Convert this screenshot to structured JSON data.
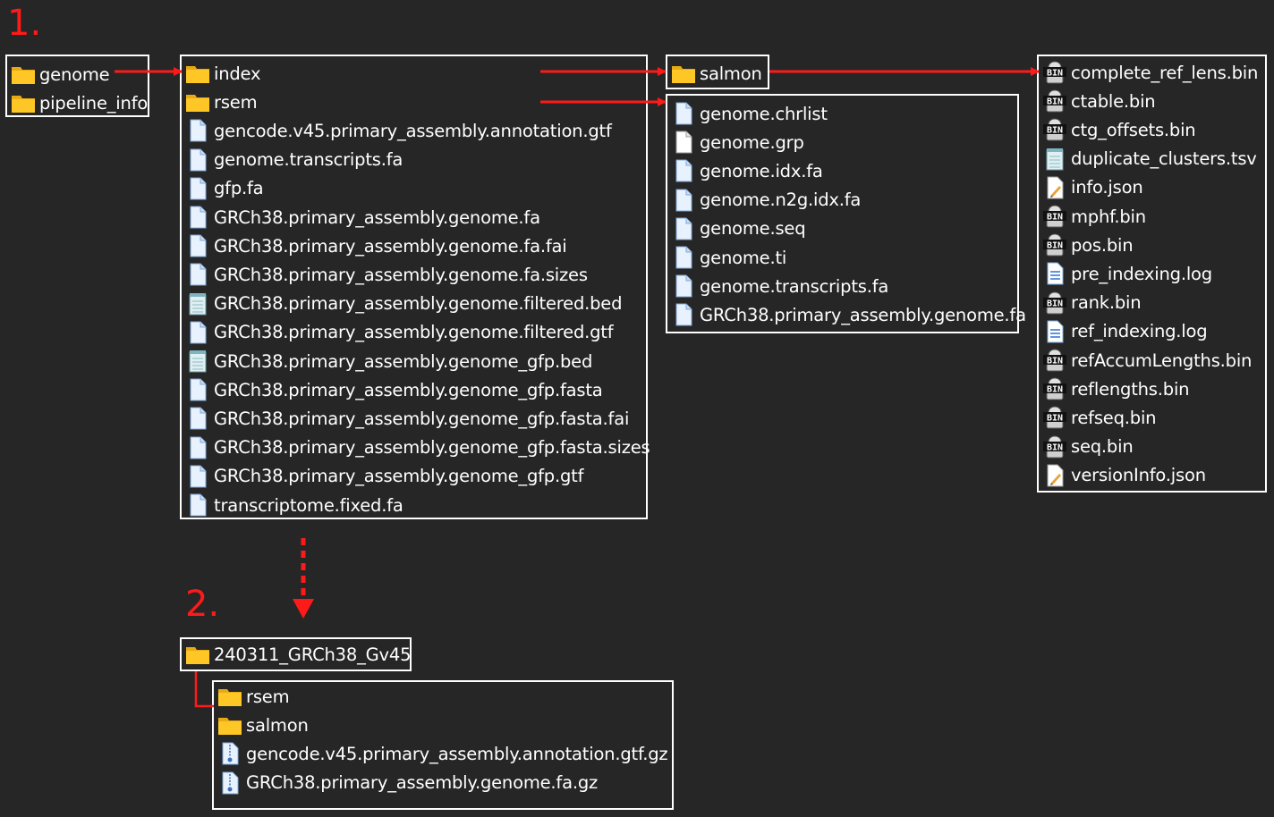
{
  "steps": {
    "one": "1.",
    "two": "2."
  },
  "colors": {
    "background": "#262626",
    "arrow": "#ff1a1a",
    "border": "#ffffff",
    "folder": "#ffc726"
  },
  "root_box": [
    {
      "name": "genome",
      "icon": "folder-icon"
    },
    {
      "name": "pipeline_info",
      "icon": "folder-icon"
    }
  ],
  "genome_box": [
    {
      "name": "index",
      "icon": "folder-icon"
    },
    {
      "name": "rsem",
      "icon": "folder-icon"
    },
    {
      "name": "gencode.v45.primary_assembly.annotation.gtf",
      "icon": "file-icon"
    },
    {
      "name": "genome.transcripts.fa",
      "icon": "file-icon"
    },
    {
      "name": "gfp.fa",
      "icon": "file-icon"
    },
    {
      "name": "GRCh38.primary_assembly.genome.fa",
      "icon": "file-icon"
    },
    {
      "name": "GRCh38.primary_assembly.genome.fa.fai",
      "icon": "file-icon"
    },
    {
      "name": "GRCh38.primary_assembly.genome.fa.sizes",
      "icon": "file-icon"
    },
    {
      "name": "GRCh38.primary_assembly.genome.filtered.bed",
      "icon": "notepad-icon"
    },
    {
      "name": "GRCh38.primary_assembly.genome.filtered.gtf",
      "icon": "file-icon"
    },
    {
      "name": "GRCh38.primary_assembly.genome_gfp.bed",
      "icon": "notepad-icon"
    },
    {
      "name": "GRCh38.primary_assembly.genome_gfp.fasta",
      "icon": "file-icon"
    },
    {
      "name": "GRCh38.primary_assembly.genome_gfp.fasta.fai",
      "icon": "file-icon"
    },
    {
      "name": "GRCh38.primary_assembly.genome_gfp.fasta.sizes",
      "icon": "file-icon"
    },
    {
      "name": "GRCh38.primary_assembly.genome_gfp.gtf",
      "icon": "file-icon"
    },
    {
      "name": "transcriptome.fixed.fa",
      "icon": "file-icon"
    }
  ],
  "index_box": [
    {
      "name": "salmon",
      "icon": "folder-icon"
    }
  ],
  "rsem_box": [
    {
      "name": "genome.chrlist",
      "icon": "file-icon"
    },
    {
      "name": "genome.grp",
      "icon": "blank-file-icon"
    },
    {
      "name": "genome.idx.fa",
      "icon": "file-icon"
    },
    {
      "name": "genome.n2g.idx.fa",
      "icon": "file-icon"
    },
    {
      "name": "genome.seq",
      "icon": "file-icon"
    },
    {
      "name": "genome.ti",
      "icon": "file-icon"
    },
    {
      "name": "genome.transcripts.fa",
      "icon": "file-icon"
    },
    {
      "name": "GRCh38.primary_assembly.genome.fa",
      "icon": "file-icon"
    }
  ],
  "salmon_box": [
    {
      "name": "complete_ref_lens.bin",
      "icon": "bin-icon"
    },
    {
      "name": "ctable.bin",
      "icon": "bin-icon"
    },
    {
      "name": "ctg_offsets.bin",
      "icon": "bin-icon"
    },
    {
      "name": "duplicate_clusters.tsv",
      "icon": "notepad-icon"
    },
    {
      "name": "info.json",
      "icon": "json-icon"
    },
    {
      "name": "mphf.bin",
      "icon": "bin-icon"
    },
    {
      "name": "pos.bin",
      "icon": "bin-icon"
    },
    {
      "name": "pre_indexing.log",
      "icon": "log-icon"
    },
    {
      "name": "rank.bin",
      "icon": "bin-icon"
    },
    {
      "name": "ref_indexing.log",
      "icon": "log-icon"
    },
    {
      "name": "refAccumLengths.bin",
      "icon": "bin-icon"
    },
    {
      "name": "reflengths.bin",
      "icon": "bin-icon"
    },
    {
      "name": "refseq.bin",
      "icon": "bin-icon"
    },
    {
      "name": "seq.bin",
      "icon": "bin-icon"
    },
    {
      "name": "versionInfo.json",
      "icon": "json-icon"
    }
  ],
  "final_root_box": [
    {
      "name": "240311_GRCh38_Gv45",
      "icon": "folder-icon"
    }
  ],
  "final_box": [
    {
      "name": "rsem",
      "icon": "folder-icon"
    },
    {
      "name": "salmon",
      "icon": "folder-icon"
    },
    {
      "name": "gencode.v45.primary_assembly.annotation.gtf.gz",
      "icon": "zip-file-icon"
    },
    {
      "name": "GRCh38.primary_assembly.genome.fa.gz",
      "icon": "zip-file-icon"
    }
  ]
}
